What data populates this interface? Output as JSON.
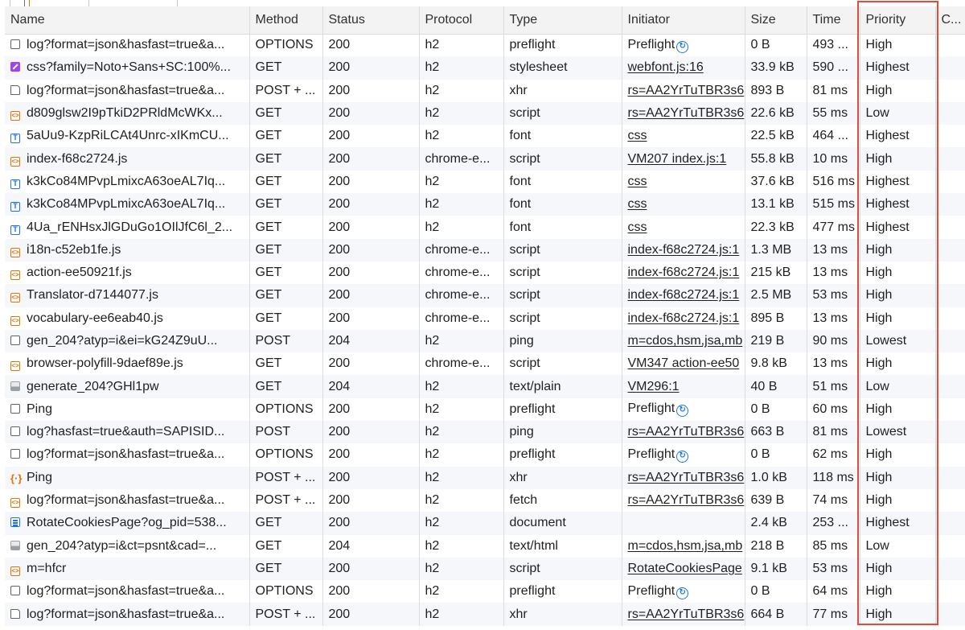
{
  "columns": [
    "Name",
    "Method",
    "Status",
    "Protocol",
    "Type",
    "Initiator",
    "Size",
    "Time",
    "Priority",
    "C..."
  ],
  "colors": {
    "highlight": "#e34c3a",
    "link": "#1f1f1f",
    "script_icon": "#e37400",
    "font_icon": "#1a73e8",
    "stylesheet_icon": "#a142f4"
  },
  "requests": [
    {
      "icon": "other-icon",
      "name": "log?format=json&hasfast=true&a...",
      "method": "OPTIONS",
      "status": "200",
      "protocol": "h2",
      "type": "preflight",
      "initiator": "Preflight",
      "preflight": true,
      "size": "0 B",
      "time": "493 ...",
      "priority": "High"
    },
    {
      "icon": "stylesheet-icon",
      "name": "css?family=Noto+Sans+SC:100%...",
      "method": "GET",
      "status": "200",
      "protocol": "h2",
      "type": "stylesheet",
      "initiator": "webfont.js:16",
      "size": "33.9 kB",
      "time": "590 ...",
      "priority": "Highest"
    },
    {
      "icon": "document-outline-icon",
      "name": "log?format=json&hasfast=true&a...",
      "method": "POST + ...",
      "status": "200",
      "protocol": "h2",
      "type": "xhr",
      "initiator": "rs=AA2YrTuTBR3s6",
      "size": "893 B",
      "time": "81 ms",
      "priority": "High"
    },
    {
      "icon": "script-icon",
      "name": "d809glsw2I9pTkiD2PRldMcWKx...",
      "method": "GET",
      "status": "200",
      "protocol": "h2",
      "type": "script",
      "initiator": "rs=AA2YrTuTBR3s6",
      "size": "22.6 kB",
      "time": "55 ms",
      "priority": "Low"
    },
    {
      "icon": "font-icon",
      "name": "5aUu9-KzpRiLCAt4Unrc-xIKmCU...",
      "method": "GET",
      "status": "200",
      "protocol": "h2",
      "type": "font",
      "initiator": "css",
      "size": "22.5 kB",
      "time": "464 ...",
      "priority": "Highest"
    },
    {
      "icon": "script-icon",
      "name": "index-f68c2724.js",
      "method": "GET",
      "status": "200",
      "protocol": "chrome-e...",
      "type": "script",
      "initiator": "VM207 index.js:1",
      "size": "55.8 kB",
      "time": "10 ms",
      "priority": "High"
    },
    {
      "icon": "font-icon",
      "name": "k3kCo84MPvpLmixcA63oeAL7Iq...",
      "method": "GET",
      "status": "200",
      "protocol": "h2",
      "type": "font",
      "initiator": "css",
      "size": "37.6 kB",
      "time": "516 ms",
      "priority": "Highest"
    },
    {
      "icon": "font-icon",
      "name": "k3kCo84MPvpLmixcA63oeAL7Iq...",
      "method": "GET",
      "status": "200",
      "protocol": "h2",
      "type": "font",
      "initiator": "css",
      "size": "13.1 kB",
      "time": "515 ms",
      "priority": "Highest"
    },
    {
      "icon": "font-icon",
      "name": "4Ua_rENHsxJlGDuGo1OIlJfC6l_2...",
      "method": "GET",
      "status": "200",
      "protocol": "h2",
      "type": "font",
      "initiator": "css",
      "size": "22.3 kB",
      "time": "477 ms",
      "priority": "Highest"
    },
    {
      "icon": "script-icon",
      "name": "i18n-c52eb1fe.js",
      "method": "GET",
      "status": "200",
      "protocol": "chrome-e...",
      "type": "script",
      "initiator": "index-f68c2724.js:1",
      "size": "1.3 MB",
      "time": "13 ms",
      "priority": "High"
    },
    {
      "icon": "script-icon",
      "name": "action-ee50921f.js",
      "method": "GET",
      "status": "200",
      "protocol": "chrome-e...",
      "type": "script",
      "initiator": "index-f68c2724.js:1",
      "size": "215 kB",
      "time": "13 ms",
      "priority": "High"
    },
    {
      "icon": "script-icon",
      "name": "Translator-d7144077.js",
      "method": "GET",
      "status": "200",
      "protocol": "chrome-e...",
      "type": "script",
      "initiator": "index-f68c2724.js:1",
      "size": "2.5 MB",
      "time": "53 ms",
      "priority": "High"
    },
    {
      "icon": "script-icon",
      "name": "vocabulary-ee6eab40.js",
      "method": "GET",
      "status": "200",
      "protocol": "chrome-e...",
      "type": "script",
      "initiator": "index-f68c2724.js:1",
      "size": "895 B",
      "time": "13 ms",
      "priority": "High"
    },
    {
      "icon": "other-icon",
      "name": "gen_204?atyp=i&ei=kG24Z9uU...",
      "method": "POST",
      "status": "204",
      "protocol": "h2",
      "type": "ping",
      "initiator": "m=cdos,hsm,jsa,mb",
      "size": "219 B",
      "time": "90 ms",
      "priority": "Lowest"
    },
    {
      "icon": "script-icon",
      "name": "browser-polyfill-9daef89e.js",
      "method": "GET",
      "status": "200",
      "protocol": "chrome-e...",
      "type": "script",
      "initiator": "VM347 action-ee50",
      "size": "9.8 kB",
      "time": "13 ms",
      "priority": "High"
    },
    {
      "icon": "image-icon",
      "name": "generate_204?GHl1pw",
      "method": "GET",
      "status": "204",
      "protocol": "h2",
      "type": "text/plain",
      "initiator": "VM296:1",
      "size": "40 B",
      "time": "51 ms",
      "priority": "Low"
    },
    {
      "icon": "other-icon",
      "name": "Ping",
      "method": "OPTIONS",
      "status": "200",
      "protocol": "h2",
      "type": "preflight",
      "initiator": "Preflight",
      "preflight": true,
      "size": "0 B",
      "time": "60 ms",
      "priority": "High"
    },
    {
      "icon": "other-icon",
      "name": "log?hasfast=true&auth=SAPISID...",
      "method": "POST",
      "status": "200",
      "protocol": "h2",
      "type": "ping",
      "initiator": "rs=AA2YrTuTBR3s6",
      "size": "663 B",
      "time": "81 ms",
      "priority": "Lowest"
    },
    {
      "icon": "other-icon",
      "name": "log?format=json&hasfast=true&a...",
      "method": "OPTIONS",
      "status": "200",
      "protocol": "h2",
      "type": "preflight",
      "initiator": "Preflight",
      "preflight": true,
      "size": "0 B",
      "time": "62 ms",
      "priority": "High"
    },
    {
      "icon": "fetch-icon",
      "name": "Ping",
      "method": "POST + ...",
      "status": "200",
      "protocol": "h2",
      "type": "xhr",
      "initiator": "rs=AA2YrTuTBR3s6",
      "size": "1.0 kB",
      "time": "118 ms",
      "priority": "High"
    },
    {
      "icon": "script-icon",
      "name": "log?format=json&hasfast=true&a...",
      "method": "POST + ...",
      "status": "200",
      "protocol": "h2",
      "type": "fetch",
      "initiator": "rs=AA2YrTuTBR3s6",
      "size": "639 B",
      "time": "74 ms",
      "priority": "High"
    },
    {
      "icon": "document-icon",
      "name": "RotateCookiesPage?og_pid=538...",
      "method": "GET",
      "status": "200",
      "protocol": "h2",
      "type": "document",
      "initiator": "",
      "size": "2.4 kB",
      "time": "253 ...",
      "priority": "Highest"
    },
    {
      "icon": "image-icon",
      "name": "gen_204?atyp=i&ct=psnt&cad=...",
      "method": "GET",
      "status": "204",
      "protocol": "h2",
      "type": "text/html",
      "initiator": "m=cdos,hsm,jsa,mb",
      "size": "218 B",
      "time": "85 ms",
      "priority": "Low"
    },
    {
      "icon": "script-icon",
      "name": "m=hfcr",
      "method": "GET",
      "status": "200",
      "protocol": "h2",
      "type": "script",
      "initiator": "RotateCookiesPage",
      "size": "9.1 kB",
      "time": "53 ms",
      "priority": "High"
    },
    {
      "icon": "other-icon",
      "name": "log?format=json&hasfast=true&a...",
      "method": "OPTIONS",
      "status": "200",
      "protocol": "h2",
      "type": "preflight",
      "initiator": "Preflight",
      "preflight": true,
      "size": "0 B",
      "time": "64 ms",
      "priority": "High"
    },
    {
      "icon": "document-outline-icon",
      "name": "log?format=json&hasfast=true&a...",
      "method": "POST + ...",
      "status": "200",
      "protocol": "h2",
      "type": "xhr",
      "initiator": "rs=AA2YrTuTBR3s6",
      "size": "664 B",
      "time": "77 ms",
      "priority": "High"
    }
  ]
}
